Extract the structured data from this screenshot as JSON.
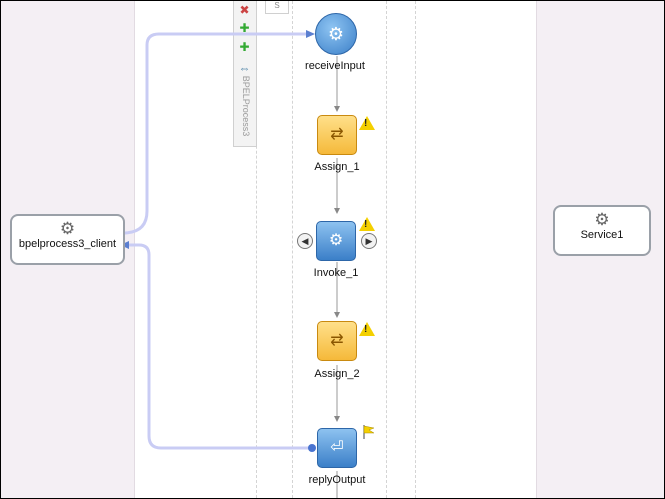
{
  "palette": {
    "label": "BPELProcess3",
    "icons": [
      "delete-marker-icon",
      "add-green-icon",
      "add-green-icon-2",
      "expand-icon"
    ]
  },
  "scope_tab": "S",
  "partners": {
    "left": {
      "label": "bpelprocess3_client",
      "icon": "gear-icon"
    },
    "right": {
      "label": "Service1",
      "icon": "gear-icon"
    }
  },
  "activities": [
    {
      "id": "receiveInput",
      "label": "receiveInput",
      "kind": "receive",
      "icon": "gear-icon"
    },
    {
      "id": "Assign_1",
      "label": "Assign_1",
      "kind": "assign",
      "icon": "assign-icon",
      "warning": true
    },
    {
      "id": "Invoke_1",
      "label": "Invoke_1",
      "kind": "invoke",
      "icon": "gear-icon",
      "warning": true
    },
    {
      "id": "Assign_2",
      "label": "Assign_2",
      "kind": "assign",
      "icon": "assign-icon",
      "warning": true
    },
    {
      "id": "replyOutput",
      "label": "replyOutput",
      "kind": "reply",
      "icon": "reply-icon",
      "flag": true
    }
  ],
  "colors": {
    "swimlane": "#f4eff4",
    "link": "#c9ccf4",
    "activity_blue": "#3b7fc8",
    "assign_yellow": "#f5b93a",
    "warning": "#f4d000"
  }
}
